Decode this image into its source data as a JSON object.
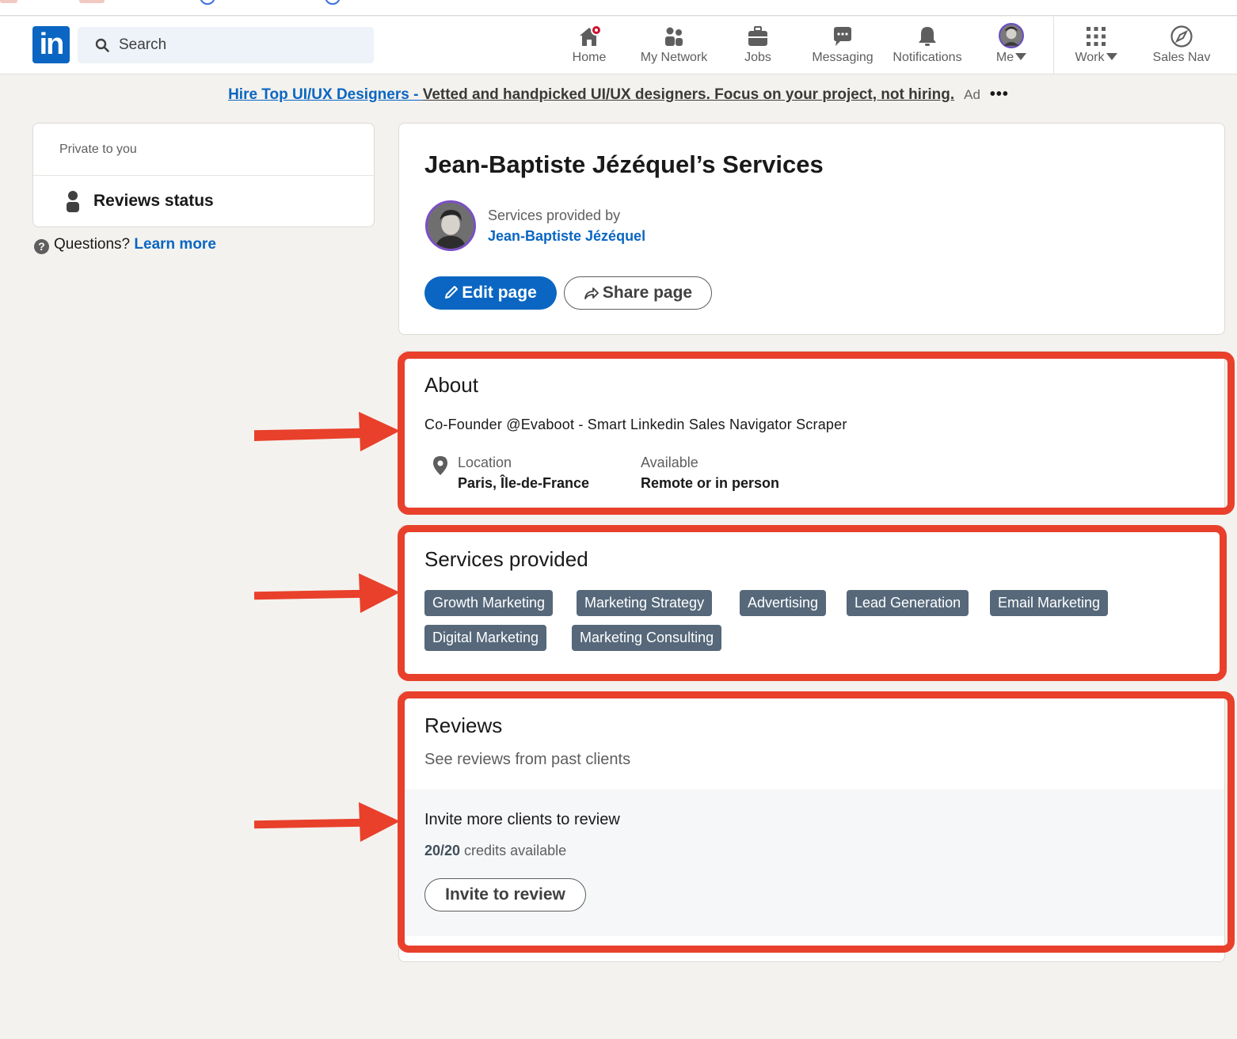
{
  "nav": {
    "search_placeholder": "Search",
    "items": [
      {
        "label": "Home",
        "icon": "home-icon"
      },
      {
        "label": "My Network",
        "icon": "network-icon"
      },
      {
        "label": "Jobs",
        "icon": "jobs-icon"
      },
      {
        "label": "Messaging",
        "icon": "messaging-icon"
      },
      {
        "label": "Notifications",
        "icon": "notifications-icon"
      },
      {
        "label": "Me",
        "icon": "avatar"
      },
      {
        "label": "Work",
        "icon": "grid-icon"
      },
      {
        "label": "Sales Nav",
        "icon": "compass-icon"
      }
    ],
    "brand_color": "#0a66c2"
  },
  "ad": {
    "link": "Hire Top UI/UX Designers - ",
    "text": "Vetted and handpicked UI/UX designers. Focus on your project, not hiring.",
    "tag": "Ad",
    "more": "•••"
  },
  "sidebar": {
    "private_label": "Private to you",
    "reviews_status": "Reviews status",
    "questions": "Questions?",
    "learn_more": "Learn more"
  },
  "header": {
    "title": "Jean-Baptiste Jézéquel’s Services",
    "provided_by": "Services provided by",
    "provider_name": "Jean-Baptiste Jézéquel",
    "edit_label": "Edit page",
    "share_label": "Share page"
  },
  "about": {
    "title": "About",
    "description": "Co-Founder @Evaboot - Smart Linkedin Sales Navigator Scraper",
    "location_label": "Location",
    "location_value": "Paris, Île-de-France",
    "available_label": "Available",
    "available_value": "Remote or in person"
  },
  "services": {
    "title": "Services provided",
    "tags": [
      "Growth Marketing",
      "Marketing Strategy",
      "Advertising",
      "Lead Generation",
      "Email Marketing",
      "Digital Marketing",
      "Marketing Consulting"
    ]
  },
  "reviews": {
    "title": "Reviews",
    "subtitle": "See reviews from past clients",
    "invite_title": "Invite more clients to review",
    "credits_count": "20/20",
    "credits_text": " credits available",
    "invite_button": "Invite to review"
  },
  "annotation_color": "#e8402b"
}
